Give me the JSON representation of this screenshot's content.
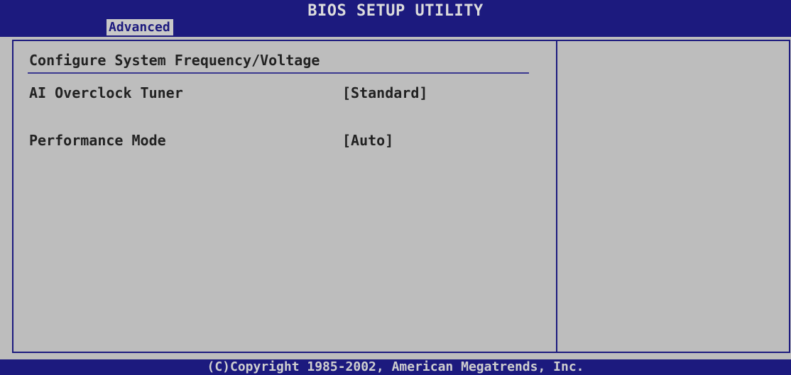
{
  "header": {
    "title": "BIOS SETUP UTILITY",
    "active_tab": "Advanced"
  },
  "panel": {
    "section_title": "Configure System Frequency/Voltage",
    "items": [
      {
        "label": "AI Overclock Tuner",
        "value": "[Standard]"
      },
      {
        "label": "Performance Mode",
        "value": "[Auto]"
      }
    ]
  },
  "footer": {
    "copyright": "(C)Copyright 1985-2002, American Megatrends, Inc."
  },
  "colors": {
    "bar": "#1c1a7e",
    "background": "#bdbdbd",
    "text": "#222222"
  }
}
